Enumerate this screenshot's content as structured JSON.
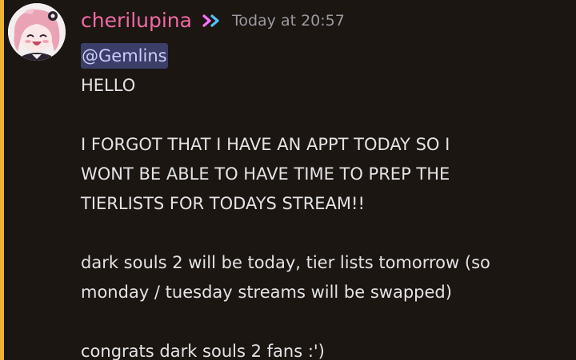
{
  "colors": {
    "background": "#1c1612",
    "mention_bar": "#f0b232",
    "username": "#ee6aa3",
    "timestamp": "#9a9aa2",
    "text": "#e3e3e6",
    "mention_bg": "#3b3f67",
    "mention_text": "#c9cdfb"
  },
  "message": {
    "author": "cherilupina",
    "badge_icon": "nitro-boost-icon",
    "timestamp": "Today at 20:57",
    "mention": "@Gemlins",
    "lines": {
      "l1": "HELLO",
      "l2": "I FORGOT THAT I HAVE AN APPT TODAY SO I",
      "l3": "WONT BE ABLE TO HAVE TIME TO PREP THE",
      "l4": "TIERLISTS FOR TODAYS STREAM!!",
      "l5": "dark souls 2 will be today, tier lists tomorrow (so",
      "l6": "monday / tuesday streams will be swapped)",
      "l7": "congrats dark souls 2 fans :')"
    }
  }
}
